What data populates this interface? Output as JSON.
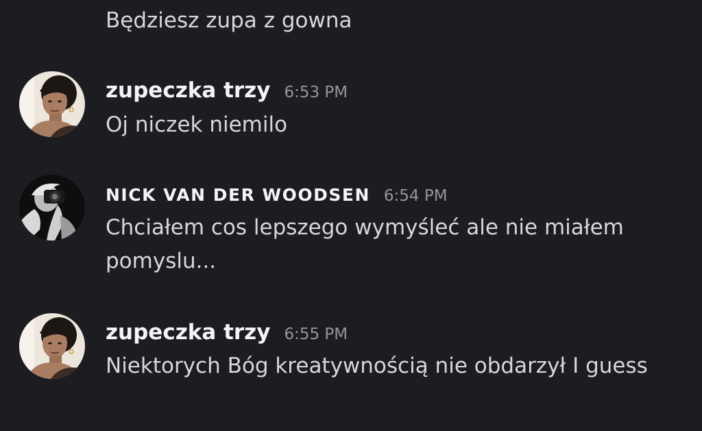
{
  "chat": {
    "continuation_text": "Będziesz zupa z gowna",
    "messages": [
      {
        "avatar": "woman-portrait-avatar",
        "username": "zupeczka trzy",
        "timestamp": "6:53 PM",
        "text": "Oj niczek niemilo"
      },
      {
        "avatar": "bw-camera-portrait-avatar",
        "username": "NICK VAN DER WOODSEN",
        "timestamp": "6:54 PM",
        "text": "Chciałem cos lepszego wymyśleć ale nie miałem pomyslu..."
      },
      {
        "avatar": "woman-portrait-avatar",
        "username": "zupeczka trzy",
        "timestamp": "6:55 PM",
        "text": "Niektorych Bóg kreatywnością nie obdarzył I guess"
      }
    ]
  },
  "colors": {
    "background": "#1c1c21",
    "message_text": "#d7d8dd",
    "username": "#f3f4f6",
    "timestamp": "#94969d"
  }
}
